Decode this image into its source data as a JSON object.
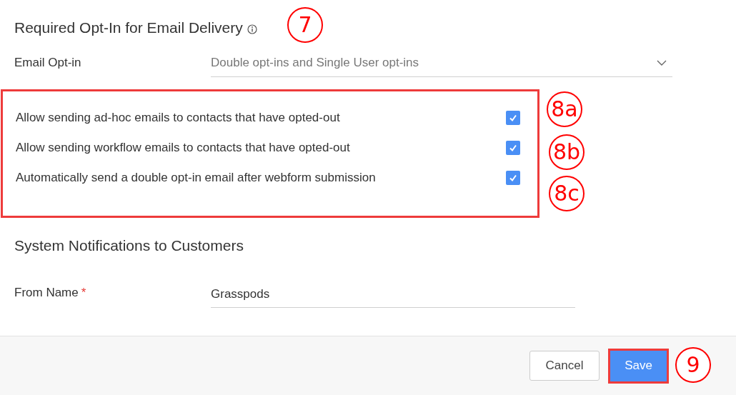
{
  "opt_in_section": {
    "title": "Required Opt-In for Email Delivery",
    "callout": "7",
    "email_opt_in": {
      "label": "Email Opt-in",
      "value": "Double opt-ins and Single User opt-ins"
    },
    "options_highlighted": true,
    "options": [
      {
        "label": "Allow sending ad-hoc emails to contacts that have opted-out",
        "checked": true,
        "callout": "8a"
      },
      {
        "label": "Allow sending workflow emails to contacts that have opted-out",
        "checked": true,
        "callout": "8b"
      },
      {
        "label": "Automatically send a double opt-in email after webform submission",
        "checked": true,
        "callout": "8c"
      }
    ]
  },
  "notifications_section": {
    "title": "System Notifications to Customers",
    "from_name": {
      "label": "From Name",
      "required_mark": "*",
      "value": "Grasspods"
    }
  },
  "footer": {
    "cancel": "Cancel",
    "save": {
      "label": "Save",
      "highlighted": true,
      "callout": "9"
    }
  }
}
